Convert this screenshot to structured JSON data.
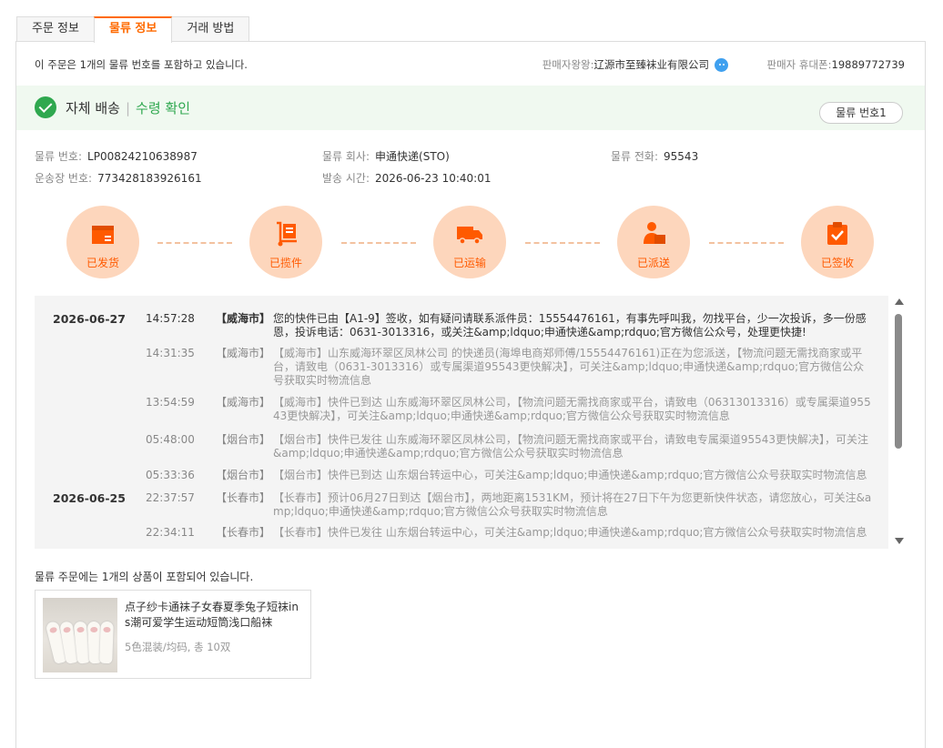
{
  "tabs": [
    {
      "label": "주문 정보",
      "active": false
    },
    {
      "label": "물류 정보",
      "active": true
    },
    {
      "label": "거래 방법",
      "active": false
    }
  ],
  "summary": "이 주문은 1개의 물류 번호를 포함하고 있습니다.",
  "seller": {
    "label": "판매자왕왕:",
    "name": "辽源市至臻袜业有限公司",
    "chat_icon": "chat-bubble-icon",
    "phone_label": "판매자 휴대폰:",
    "phone": "19889772739"
  },
  "status": {
    "type": "자체 배송",
    "separator": "|",
    "confirm": "수령 확인",
    "color": "#2fa84f",
    "track_button": "물류 번호1"
  },
  "info": {
    "logistics_no_label": "물류 번호:",
    "logistics_no": "LP00824210638987",
    "waybill_label": "운송장 번호:",
    "waybill": "773428183926161",
    "company_label": "물류 회사:",
    "company": "申通快递(STO)",
    "ship_time_label": "발송 시간:",
    "ship_time": "2026-06-23 10:40:01",
    "phone_label": "물류 전화:",
    "phone": "95543"
  },
  "steps": [
    {
      "label": "已发货",
      "icon": "box-icon"
    },
    {
      "label": "已揽件",
      "icon": "hand-truck-icon"
    },
    {
      "label": "已运输",
      "icon": "delivery-truck-icon"
    },
    {
      "label": "已派送",
      "icon": "courier-icon"
    },
    {
      "label": "已签收",
      "icon": "clipboard-check-icon"
    }
  ],
  "step_color": "#ff5a00",
  "log": [
    {
      "date": "2026-06-27",
      "time": "14:57:28",
      "city": "【威海市】",
      "msg": "您的快件已由【A1-9】签收，如有疑问请联系派件员：15554476161，有事先呼叫我，勿找平台，少一次投诉，多一份感恩，投诉电话：0631-3013316，或关注&amp;ldquo;申通快递&amp;rdquo;官方微信公众号，处理更快捷!"
    },
    {
      "date": "",
      "time": "14:31:35",
      "city": "【威海市】",
      "msg": "【威海市】山东威海环翠区凤林公司 的快递员(海埠电商郑师傅/15554476161)正在为您派送，【物流问题无需找商家或平台，请致电（0631-3013316）或专属渠道95543更快解决】，可关注&amp;ldquo;申通快递&amp;rdquo;官方微信公众号获取实时物流信息"
    },
    {
      "date": "",
      "time": "13:54:59",
      "city": "【威海市】",
      "msg": "【威海市】快件已到达 山东威海环翠区凤林公司，【物流问题无需找商家或平台，请致电（06313013316）或专属渠道95543更快解决】，可关注&amp;ldquo;申通快递&amp;rdquo;官方微信公众号获取实时物流信息"
    },
    {
      "date": "",
      "time": "05:48:00",
      "city": "【烟台市】",
      "msg": "【烟台市】快件已发往 山东威海环翠区凤林公司，【物流问题无需找商家或平台，请致电专属渠道95543更快解决】，可关注&amp;ldquo;申通快递&amp;rdquo;官方微信公众号获取实时物流信息"
    },
    {
      "date": "",
      "time": "05:33:36",
      "city": "【烟台市】",
      "msg": "【烟台市】快件已到达 山东烟台转运中心，可关注&amp;ldquo;申通快递&amp;rdquo;官方微信公众号获取实时物流信息"
    },
    {
      "date": "2026-06-25",
      "time": "22:37:57",
      "city": "【长春市】",
      "msg": "【长春市】预计06月27日到达【烟台市】，两地距离1531KM，预计将在27日下午为您更新快件状态，请您放心，可关注&amp;ldquo;申通快递&amp;rdquo;官方微信公众号获取实时物流信息"
    },
    {
      "date": "",
      "time": "22:34:11",
      "city": "【长春市】",
      "msg": "【长春市】快件已发往 山东烟台转运中心，可关注&amp;ldquo;申通快递&amp;rdquo;官方微信公众号获取实时物流信息"
    }
  ],
  "products_label": "물류 주문에는 1개의 상품이 포함되어 있습니다.",
  "product": {
    "title": "点子纱卡通袜子女春夏季兔子短袜ins潮可爱学生运动短筒浅口船袜",
    "spec": "5色混装/均码, 총 10双"
  }
}
